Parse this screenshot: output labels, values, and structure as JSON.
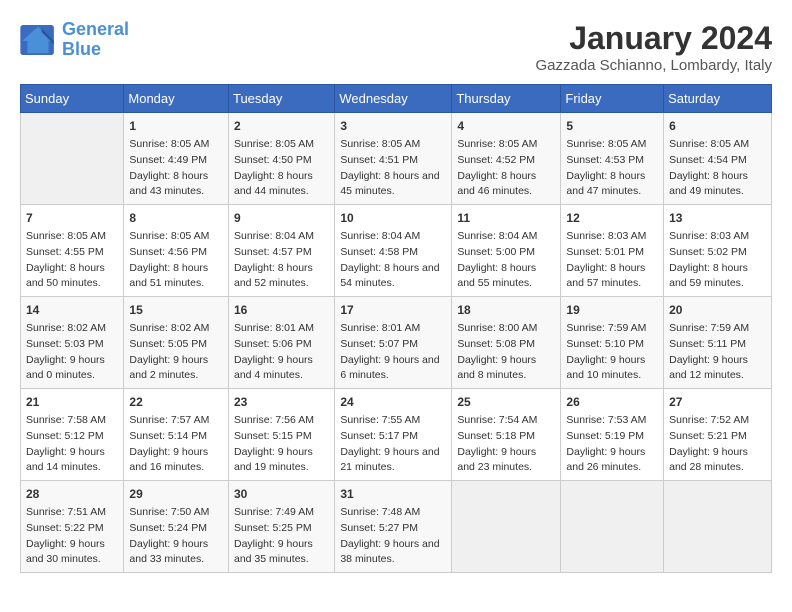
{
  "logo": {
    "line1": "General",
    "line2": "Blue"
  },
  "title": "January 2024",
  "subtitle": "Gazzada Schianno, Lombardy, Italy",
  "days_of_week": [
    "Sunday",
    "Monday",
    "Tuesday",
    "Wednesday",
    "Thursday",
    "Friday",
    "Saturday"
  ],
  "weeks": [
    [
      {
        "day": "",
        "sunrise": "",
        "sunset": "",
        "daylight": ""
      },
      {
        "day": "1",
        "sunrise": "Sunrise: 8:05 AM",
        "sunset": "Sunset: 4:49 PM",
        "daylight": "Daylight: 8 hours and 43 minutes."
      },
      {
        "day": "2",
        "sunrise": "Sunrise: 8:05 AM",
        "sunset": "Sunset: 4:50 PM",
        "daylight": "Daylight: 8 hours and 44 minutes."
      },
      {
        "day": "3",
        "sunrise": "Sunrise: 8:05 AM",
        "sunset": "Sunset: 4:51 PM",
        "daylight": "Daylight: 8 hours and 45 minutes."
      },
      {
        "day": "4",
        "sunrise": "Sunrise: 8:05 AM",
        "sunset": "Sunset: 4:52 PM",
        "daylight": "Daylight: 8 hours and 46 minutes."
      },
      {
        "day": "5",
        "sunrise": "Sunrise: 8:05 AM",
        "sunset": "Sunset: 4:53 PM",
        "daylight": "Daylight: 8 hours and 47 minutes."
      },
      {
        "day": "6",
        "sunrise": "Sunrise: 8:05 AM",
        "sunset": "Sunset: 4:54 PM",
        "daylight": "Daylight: 8 hours and 49 minutes."
      }
    ],
    [
      {
        "day": "7",
        "sunrise": "Sunrise: 8:05 AM",
        "sunset": "Sunset: 4:55 PM",
        "daylight": "Daylight: 8 hours and 50 minutes."
      },
      {
        "day": "8",
        "sunrise": "Sunrise: 8:05 AM",
        "sunset": "Sunset: 4:56 PM",
        "daylight": "Daylight: 8 hours and 51 minutes."
      },
      {
        "day": "9",
        "sunrise": "Sunrise: 8:04 AM",
        "sunset": "Sunset: 4:57 PM",
        "daylight": "Daylight: 8 hours and 52 minutes."
      },
      {
        "day": "10",
        "sunrise": "Sunrise: 8:04 AM",
        "sunset": "Sunset: 4:58 PM",
        "daylight": "Daylight: 8 hours and 54 minutes."
      },
      {
        "day": "11",
        "sunrise": "Sunrise: 8:04 AM",
        "sunset": "Sunset: 5:00 PM",
        "daylight": "Daylight: 8 hours and 55 minutes."
      },
      {
        "day": "12",
        "sunrise": "Sunrise: 8:03 AM",
        "sunset": "Sunset: 5:01 PM",
        "daylight": "Daylight: 8 hours and 57 minutes."
      },
      {
        "day": "13",
        "sunrise": "Sunrise: 8:03 AM",
        "sunset": "Sunset: 5:02 PM",
        "daylight": "Daylight: 8 hours and 59 minutes."
      }
    ],
    [
      {
        "day": "14",
        "sunrise": "Sunrise: 8:02 AM",
        "sunset": "Sunset: 5:03 PM",
        "daylight": "Daylight: 9 hours and 0 minutes."
      },
      {
        "day": "15",
        "sunrise": "Sunrise: 8:02 AM",
        "sunset": "Sunset: 5:05 PM",
        "daylight": "Daylight: 9 hours and 2 minutes."
      },
      {
        "day": "16",
        "sunrise": "Sunrise: 8:01 AM",
        "sunset": "Sunset: 5:06 PM",
        "daylight": "Daylight: 9 hours and 4 minutes."
      },
      {
        "day": "17",
        "sunrise": "Sunrise: 8:01 AM",
        "sunset": "Sunset: 5:07 PM",
        "daylight": "Daylight: 9 hours and 6 minutes."
      },
      {
        "day": "18",
        "sunrise": "Sunrise: 8:00 AM",
        "sunset": "Sunset: 5:08 PM",
        "daylight": "Daylight: 9 hours and 8 minutes."
      },
      {
        "day": "19",
        "sunrise": "Sunrise: 7:59 AM",
        "sunset": "Sunset: 5:10 PM",
        "daylight": "Daylight: 9 hours and 10 minutes."
      },
      {
        "day": "20",
        "sunrise": "Sunrise: 7:59 AM",
        "sunset": "Sunset: 5:11 PM",
        "daylight": "Daylight: 9 hours and 12 minutes."
      }
    ],
    [
      {
        "day": "21",
        "sunrise": "Sunrise: 7:58 AM",
        "sunset": "Sunset: 5:12 PM",
        "daylight": "Daylight: 9 hours and 14 minutes."
      },
      {
        "day": "22",
        "sunrise": "Sunrise: 7:57 AM",
        "sunset": "Sunset: 5:14 PM",
        "daylight": "Daylight: 9 hours and 16 minutes."
      },
      {
        "day": "23",
        "sunrise": "Sunrise: 7:56 AM",
        "sunset": "Sunset: 5:15 PM",
        "daylight": "Daylight: 9 hours and 19 minutes."
      },
      {
        "day": "24",
        "sunrise": "Sunrise: 7:55 AM",
        "sunset": "Sunset: 5:17 PM",
        "daylight": "Daylight: 9 hours and 21 minutes."
      },
      {
        "day": "25",
        "sunrise": "Sunrise: 7:54 AM",
        "sunset": "Sunset: 5:18 PM",
        "daylight": "Daylight: 9 hours and 23 minutes."
      },
      {
        "day": "26",
        "sunrise": "Sunrise: 7:53 AM",
        "sunset": "Sunset: 5:19 PM",
        "daylight": "Daylight: 9 hours and 26 minutes."
      },
      {
        "day": "27",
        "sunrise": "Sunrise: 7:52 AM",
        "sunset": "Sunset: 5:21 PM",
        "daylight": "Daylight: 9 hours and 28 minutes."
      }
    ],
    [
      {
        "day": "28",
        "sunrise": "Sunrise: 7:51 AM",
        "sunset": "Sunset: 5:22 PM",
        "daylight": "Daylight: 9 hours and 30 minutes."
      },
      {
        "day": "29",
        "sunrise": "Sunrise: 7:50 AM",
        "sunset": "Sunset: 5:24 PM",
        "daylight": "Daylight: 9 hours and 33 minutes."
      },
      {
        "day": "30",
        "sunrise": "Sunrise: 7:49 AM",
        "sunset": "Sunset: 5:25 PM",
        "daylight": "Daylight: 9 hours and 35 minutes."
      },
      {
        "day": "31",
        "sunrise": "Sunrise: 7:48 AM",
        "sunset": "Sunset: 5:27 PM",
        "daylight": "Daylight: 9 hours and 38 minutes."
      },
      {
        "day": "",
        "sunrise": "",
        "sunset": "",
        "daylight": ""
      },
      {
        "day": "",
        "sunrise": "",
        "sunset": "",
        "daylight": ""
      },
      {
        "day": "",
        "sunrise": "",
        "sunset": "",
        "daylight": ""
      }
    ]
  ]
}
